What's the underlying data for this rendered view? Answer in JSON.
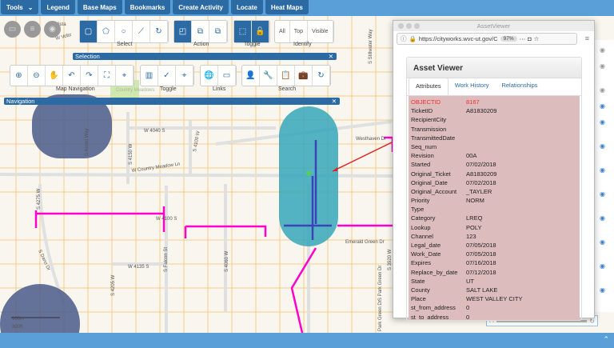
{
  "topbar": {
    "items": [
      "Tools",
      "Legend",
      "Base Maps",
      "Bookmarks",
      "Create Activity",
      "Locate",
      "Heat Maps"
    ]
  },
  "selection": {
    "title": "Selection",
    "groups": [
      "Select",
      "Action",
      "Toggle",
      "Identify"
    ],
    "identify_buttons": [
      "All",
      "Top",
      "Visible"
    ]
  },
  "navigation": {
    "title": "Navigation",
    "groups": [
      "Map Navigation",
      "Toggle",
      "Links",
      "Search"
    ]
  },
  "map": {
    "labels": [
      "W 4040 S",
      "S 4150 W",
      "S 4100 W",
      "W Country Meadow Ln",
      "S Acord Way",
      "W 4100 S",
      "S 4275 W",
      "S Dano Dr",
      "W 4135 S",
      "S 4205 W",
      "S Falcon St",
      "S 4060 W",
      "Westhaven Dr",
      "Emerald Green Dr",
      "S 3920 W",
      "S Park Green Dr",
      "Park Green Dr",
      "S Stillwater Way",
      "W Vista",
      "W Voltz",
      "Country Meadows"
    ],
    "scale": {
      "m": "100m",
      "ft": "300ft"
    }
  },
  "browser": {
    "title": "AssetViewer",
    "url": "https://cityworks.wvc-ut.gov/C",
    "zoom": "97%"
  },
  "asset_viewer": {
    "title": "Asset Viewer",
    "tabs": [
      "Attributes",
      "Work History",
      "Relationships"
    ],
    "rows": [
      [
        "OBJECTID",
        "8167"
      ],
      [
        "TicketID",
        "A81830209"
      ],
      [
        "RecipientCity",
        ""
      ],
      [
        "Transmission",
        ""
      ],
      [
        "TransmittedDate",
        ""
      ],
      [
        "Seq_num",
        ""
      ],
      [
        "Revision",
        "00A"
      ],
      [
        "Started",
        "07/02/2018"
      ],
      [
        "Original_Ticket",
        "A81830209"
      ],
      [
        "Original_Date",
        "07/02/2018"
      ],
      [
        "Original_Account",
        "_TAYLER"
      ],
      [
        "Priority",
        "NORM"
      ],
      [
        "Type",
        ""
      ],
      [
        "Category",
        "LREQ"
      ],
      [
        "Lookup",
        "POLY"
      ],
      [
        "Channel",
        "123"
      ],
      [
        "Legal_date",
        "07/05/2018"
      ],
      [
        "Work_Date",
        "07/05/2018"
      ],
      [
        "Expires",
        "07/16/2018"
      ],
      [
        "Replace_by_date",
        "07/12/2018"
      ],
      [
        "State",
        "UT"
      ],
      [
        "County",
        "SALT LAKE"
      ],
      [
        "Place",
        "WEST VALLEY CITY"
      ],
      [
        "st_from_address",
        "0"
      ],
      [
        "st_to_address",
        "0"
      ]
    ]
  },
  "colors": {
    "accent": "#2b6aa3",
    "topbar": "#5b9fd8",
    "highlight_rows": "#dcbcbc",
    "buffer": "#2aa3b8",
    "utility": "#ff00cc"
  }
}
